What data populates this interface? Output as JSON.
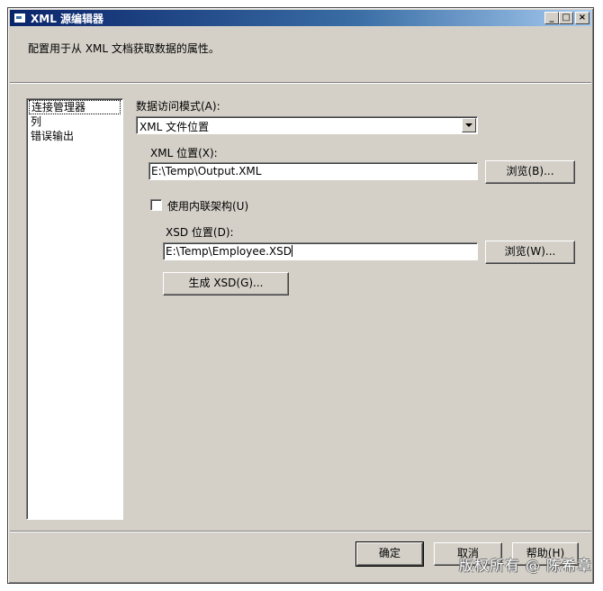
{
  "window": {
    "title": "XML 源编辑器",
    "buttons": {
      "minimize": "_",
      "maximize": "□",
      "close": "×"
    }
  },
  "description": "配置用于从 XML 文档获取数据的属性。",
  "nav": {
    "items": [
      {
        "label": "连接管理器",
        "selected": true
      },
      {
        "label": "列",
        "selected": false
      },
      {
        "label": "错误输出",
        "selected": false
      }
    ]
  },
  "access_mode": {
    "label": "数据访问模式(A):",
    "value": "XML 文件位置"
  },
  "xml_location": {
    "label": "XML 位置(X):",
    "value": "E:\\Temp\\Output.XML",
    "browse_label": "浏览(B)..."
  },
  "inline_schema": {
    "label": "使用内联架构(U)",
    "checked": false
  },
  "xsd_location": {
    "label": "XSD 位置(D):",
    "value": "E:\\Temp\\Employee.XSD",
    "browse_label": "浏览(W)...",
    "generate_label": "生成 XSD(G)..."
  },
  "footer": {
    "ok_label": "确定",
    "cancel_label": "取消",
    "help_label": "帮助(H)"
  },
  "watermark": "版权所有 @ 陈希章"
}
